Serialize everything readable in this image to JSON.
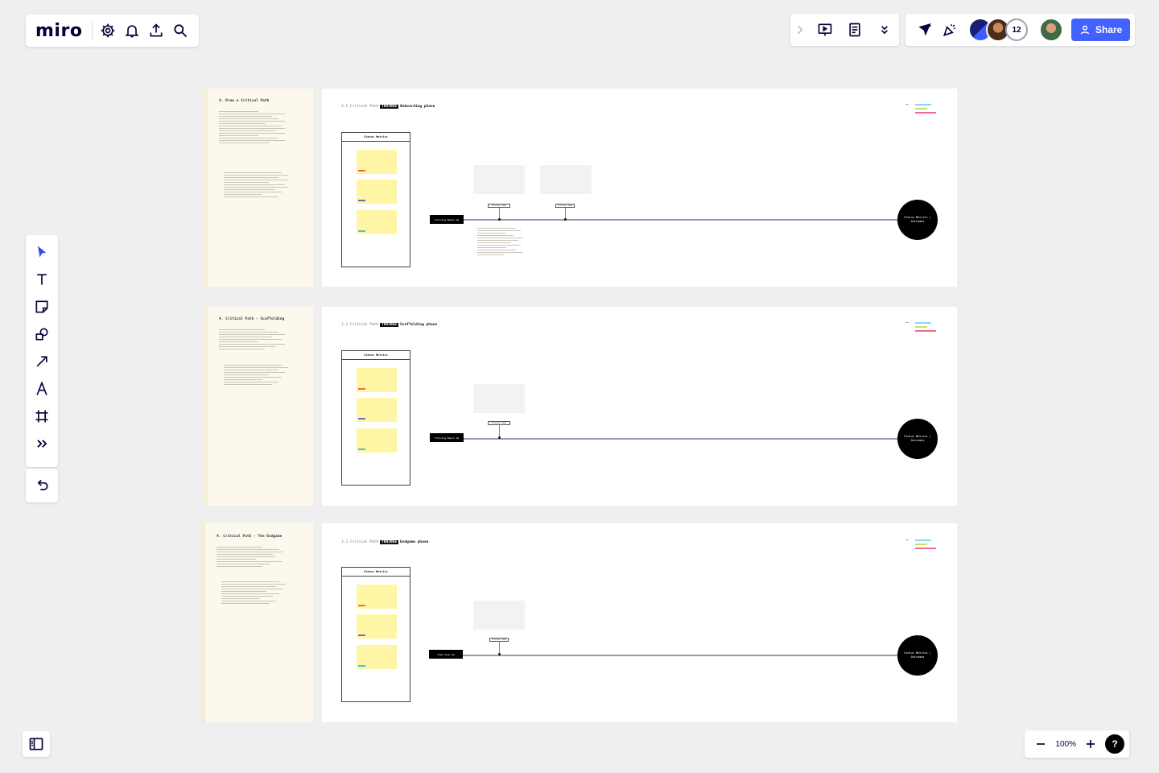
{
  "app": {
    "logo": "miro"
  },
  "toolbar_left": {
    "icons": [
      "gear-icon",
      "bell-icon",
      "upload-icon",
      "search-icon"
    ]
  },
  "toolbar_right": {
    "icons": [
      "chevron-right-icon",
      "presentation-icon",
      "notes-icon",
      "double-chevron-down-icon"
    ]
  },
  "collab": {
    "participant_count": "12",
    "share_label": "Share"
  },
  "tools": [
    "select",
    "text",
    "sticky-note",
    "shapes",
    "connector",
    "pen",
    "frame",
    "more",
    "undo"
  ],
  "zoom": {
    "level": "100%",
    "help": "?"
  },
  "board": {
    "rows": [
      {
        "side_title": "4. Draw a Critical Path",
        "main_title_prefix": "3.1 Critical Path",
        "main_title_tag": "TRAINEE",
        "main_title_phase": "Onboarding phase",
        "metrics_label": "Status Metrics",
        "start_label": "Training Begin Up",
        "goal_label": "Status Metrics | Outcomes",
        "step_labels": [
          "Process name",
          "Process name"
        ]
      },
      {
        "side_title": "4. Critical Path - Scaffolding",
        "main_title_prefix": "3.2 Critical Path",
        "main_title_tag": "TRAINEE",
        "main_title_phase": "Scaffolding phase",
        "metrics_label": "Status Metrics",
        "start_label": "Training Begin Up",
        "goal_label": "Status Metrics | Outcomes",
        "step_labels": [
          "Process name"
        ]
      },
      {
        "side_title": "4. Critical Path - The Endgame",
        "main_title_prefix": "3.3 Critical Path",
        "main_title_tag": "TRAINEE",
        "main_title_phase": "Endgame phase",
        "metrics_label": "Status Metrics",
        "start_label": "Team Sign Up",
        "goal_label": "Status Metrics | Outcomes",
        "step_labels": [
          "Process name"
        ]
      }
    ]
  },
  "colors": {
    "brand_blue": "#4262ff",
    "sticky_yellow": "#fff6a5",
    "tag_red": "#f26b4e",
    "tag_purple": "#6c6fc4",
    "tag_cyan": "#3fc3e0",
    "legend_blue": "#8fd3f0",
    "legend_green": "#c3e26b",
    "legend_red": "#f26b8c"
  }
}
